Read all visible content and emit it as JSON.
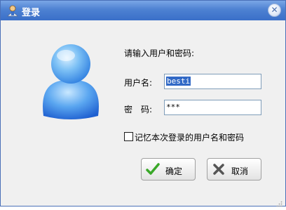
{
  "window": {
    "title": "登录",
    "close_label": "✕"
  },
  "form": {
    "prompt": "请输入用户和密码:",
    "username_label": "用户名:",
    "username_value": "besti",
    "password_label": "密　码:",
    "password_value": "***",
    "remember_label": "记忆本次登录的用户名和密码",
    "remember_checked": false
  },
  "buttons": {
    "ok_label": "确定",
    "cancel_label": "取消"
  },
  "colors": {
    "titlebar": "#3a6fc8",
    "ok_check": "#3aa829",
    "cancel_x": "#4a4a4a",
    "avatar": "#3b8fe8"
  },
  "icons": {
    "app": "user-icon",
    "avatar": "user-avatar-icon",
    "ok": "checkmark-icon",
    "cancel": "x-icon"
  }
}
